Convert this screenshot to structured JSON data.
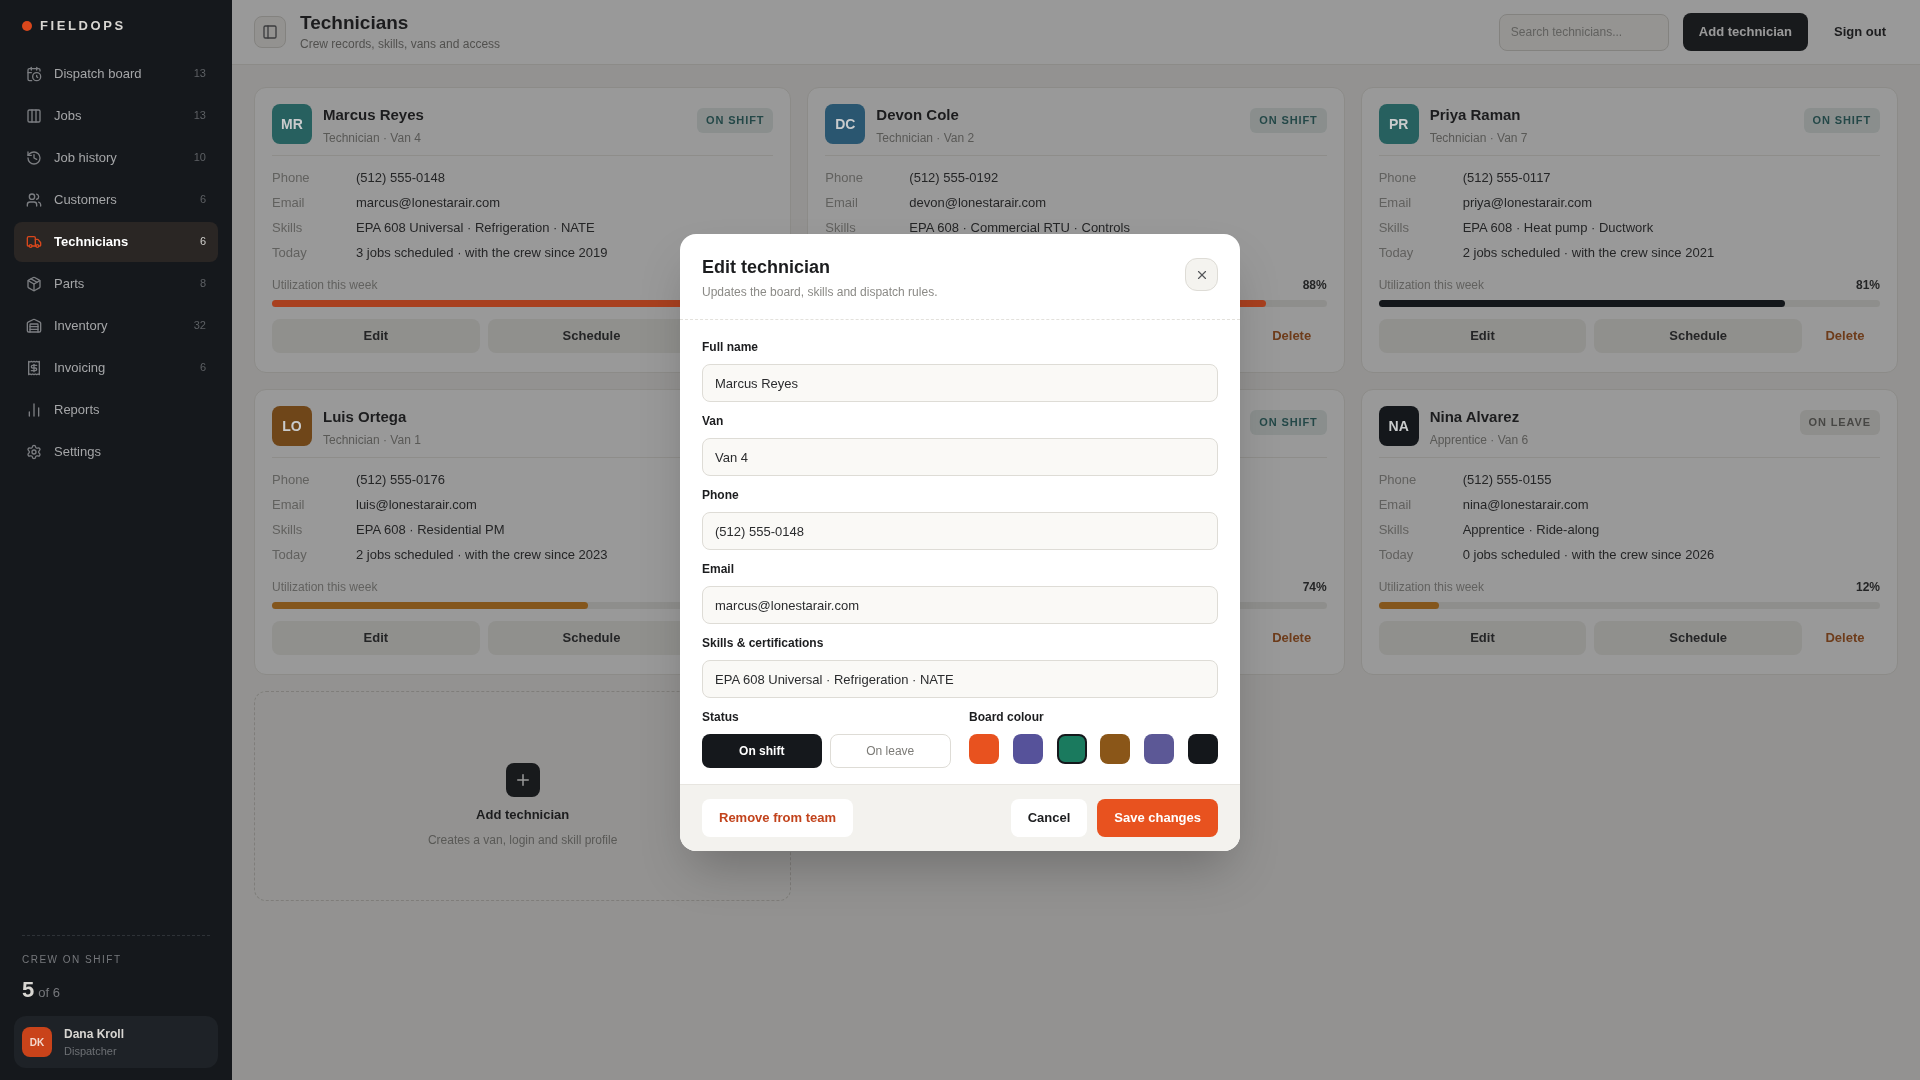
{
  "sidebar": {
    "brand": "FIELDOPS",
    "nav": [
      {
        "label": "Dispatch board",
        "count": "13",
        "selected": false
      },
      {
        "label": "Jobs",
        "count": "13",
        "selected": false
      },
      {
        "label": "Job history",
        "count": "10",
        "selected": false
      },
      {
        "label": "Customers",
        "count": "6",
        "selected": false
      },
      {
        "label": "Technicians",
        "count": "6",
        "selected": true
      },
      {
        "label": "Parts",
        "count": "8",
        "selected": false
      },
      {
        "label": "Inventory",
        "count": "32",
        "selected": false
      },
      {
        "label": "Invoicing",
        "count": "6",
        "selected": false
      },
      {
        "label": "Reports",
        "selected": false
      },
      {
        "label": "Settings",
        "selected": false
      }
    ],
    "crew": {
      "label": "CREW ON SHIFT",
      "value": "5",
      "total": "of 6"
    },
    "user": {
      "initials": "DK",
      "name": "Dana Kroll",
      "role": "Dispatcher"
    }
  },
  "header": {
    "title": "Technicians",
    "subtitle": "Crew records, skills, vans and access",
    "search_placeholder": "Search technicians...",
    "add_button": "Add technician",
    "sign_out": "Sign out"
  },
  "cards": [
    {
      "avatar": {
        "initials": "MR",
        "color": "#27605f"
      },
      "name": "Marcus Reyes",
      "role": "Technician · Van 4",
      "status": {
        "label": "ON SHIFT",
        "kind": "on_shift"
      },
      "details": [
        {
          "label": "Phone",
          "value": "(512) 555-0148"
        },
        {
          "label": "Email",
          "value": "marcus@lonestarair.com"
        },
        {
          "label": "Skills",
          "value": "EPA 608 Universal · Refrigeration · NATE"
        },
        {
          "label": "Today",
          "value": "3 jobs scheduled · with the crew since 2019"
        }
      ],
      "utilization": {
        "label": "Utilization this week",
        "level": 0.92,
        "color": "#a8401f"
      },
      "actions": {
        "edit": "Edit",
        "schedule": "Schedule"
      }
    },
    {
      "avatar": {
        "initials": "DC",
        "color": "#2a5670"
      },
      "name": "Devon Cole",
      "role": "Technician · Van 2",
      "status": {
        "label": "ON SHIFT",
        "kind": "on_shift"
      },
      "details": [
        {
          "label": "Phone",
          "value": "(512) 555-0192"
        },
        {
          "label": "Email",
          "value": "devon@lonestarair.com"
        },
        {
          "label": "Skills",
          "value": "EPA 608 · Commercial RTU · Controls"
        }
      ],
      "utilization": {
        "reading": "88%",
        "level": 0.88,
        "color": "#a8401f"
      },
      "actions": {
        "delete": "Delete"
      }
    },
    {
      "avatar": {
        "initials": "PR",
        "color": "#27605f"
      },
      "name": "Priya Raman",
      "role": "Technician · Van 7",
      "status": {
        "label": "ON SHIFT",
        "kind": "on_shift"
      },
      "details": [
        {
          "label": "Phone",
          "value": "(512) 555-0117"
        },
        {
          "label": "Email",
          "value": "priya@lonestarair.com"
        },
        {
          "label": "Skills",
          "value": "EPA 608 · Heat pump · Ductwork"
        },
        {
          "label": "Today",
          "value": "2 jobs scheduled · with the crew since 2021"
        }
      ],
      "utilization": {
        "label": "Utilization this week",
        "reading": "81%",
        "level": 0.81,
        "color": "#14171b"
      },
      "actions": {
        "edit": "Edit",
        "schedule": "Schedule",
        "delete": "Delete"
      }
    },
    {
      "avatar": {
        "initials": "LO",
        "color": "#6f4619"
      },
      "name": "Luis Ortega",
      "role": "Technician · Van 1",
      "details": [
        {
          "label": "Phone",
          "value": "(512) 555-0176"
        },
        {
          "label": "Email",
          "value": "luis@lonestarair.com"
        },
        {
          "label": "Skills",
          "value": "EPA 608 · Residential PM"
        },
        {
          "label": "Today",
          "value": "2 jobs scheduled · with the crew since 2023"
        }
      ],
      "utilization": {
        "label": "Utilization this week",
        "level": 0.63,
        "color": "#84561c"
      },
      "actions": {
        "edit": "Edit",
        "schedule": "Schedule"
      }
    },
    {
      "status": {
        "label": "ON SHIFT",
        "kind": "on_shift"
      },
      "utilization": {
        "reading": "74%"
      },
      "actions": {
        "delete": "Delete"
      }
    },
    {
      "avatar": {
        "initials": "NA",
        "color": "#14171b"
      },
      "name": "Nina Alvarez",
      "role": "Apprentice · Van 6",
      "status": {
        "label": "ON LEAVE",
        "kind": "on_leave"
      },
      "details": [
        {
          "label": "Phone",
          "value": "(512) 555-0155"
        },
        {
          "label": "Email",
          "value": "nina@lonestarair.com"
        },
        {
          "label": "Skills",
          "value": "Apprentice · Ride-along"
        },
        {
          "label": "Today",
          "value": "0 jobs scheduled · with the crew since 2026"
        }
      ],
      "utilization": {
        "label": "Utilization this week",
        "reading": "12%",
        "level": 0.12,
        "color": "#84561c"
      },
      "actions": {
        "edit": "Edit",
        "schedule": "Schedule",
        "delete": "Delete"
      }
    }
  ],
  "add_card": {
    "title": "Add technician",
    "description": "Creates a van, login and skill profile"
  },
  "modal": {
    "title": "Edit technician",
    "subtitle": "Updates the board, skills and dispatch rules.",
    "fields": [
      {
        "label": "Full name",
        "value": "Marcus Reyes"
      },
      {
        "label": "Van",
        "value": "Van 4"
      },
      {
        "label": "Phone",
        "value": "(512) 555-0148"
      },
      {
        "label": "Email",
        "value": "marcus@lonestarair.com"
      },
      {
        "label": "Skills & certifications",
        "value": "EPA 608 Universal · Refrigeration · NATE"
      }
    ],
    "status": {
      "label": "Status",
      "options": [
        {
          "label": "On shift",
          "selected": true
        },
        {
          "label": "On leave",
          "selected": false
        }
      ]
    },
    "board_colour": {
      "label": "Board colour",
      "swatches": [
        {
          "color": "#e8521f",
          "selected": false
        },
        {
          "color": "#56529a",
          "selected": false
        },
        {
          "color": "#1a7a5e",
          "selected": true
        },
        {
          "color": "#8a5618",
          "selected": false
        },
        {
          "color": "#5c5896",
          "selected": false
        },
        {
          "color": "#14171b",
          "selected": false
        }
      ]
    },
    "remove_button": "Remove from team",
    "cancel_button": "Cancel",
    "save_button": "Save changes"
  }
}
